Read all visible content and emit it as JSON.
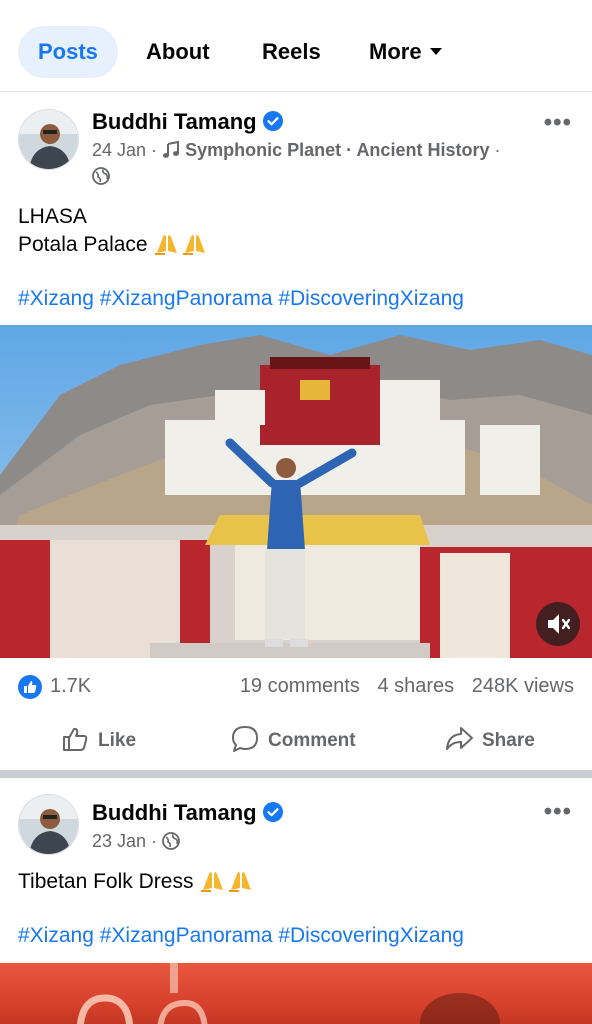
{
  "tabs": {
    "posts": "Posts",
    "about": "About",
    "reels": "Reels",
    "more": "More"
  },
  "post1": {
    "author": "Buddhi Tamang",
    "date": "24 Jan",
    "music": "Symphonic Planet",
    "category": "Ancient History",
    "text_line1": "LHASA",
    "text_line2": "Potala Palace",
    "hashtags": "#Xizang #XizangPanorama #DiscoveringXizang",
    "likes": "1.7K",
    "comments": "19 comments",
    "shares": "4 shares",
    "views": "248K views",
    "actions": {
      "like": "Like",
      "comment": "Comment",
      "share": "Share"
    }
  },
  "post2": {
    "author": "Buddhi Tamang",
    "date": "23 Jan",
    "text": "Tibetan Folk Dress",
    "hashtags": "#Xizang #XizangPanorama #DiscoveringXizang"
  },
  "icons": {
    "verified": "verified-badge-icon",
    "music": "music-note-icon",
    "globe": "globe-icon",
    "more": "more-dots-icon",
    "like": "thumbs-up-icon",
    "comment": "comment-bubble-icon",
    "share": "share-arrow-icon",
    "mute": "speaker-muted-icon"
  },
  "colors": {
    "accent": "#1877f2",
    "muted_text": "#65676b",
    "tab_active_bg": "#e7f1fd"
  }
}
